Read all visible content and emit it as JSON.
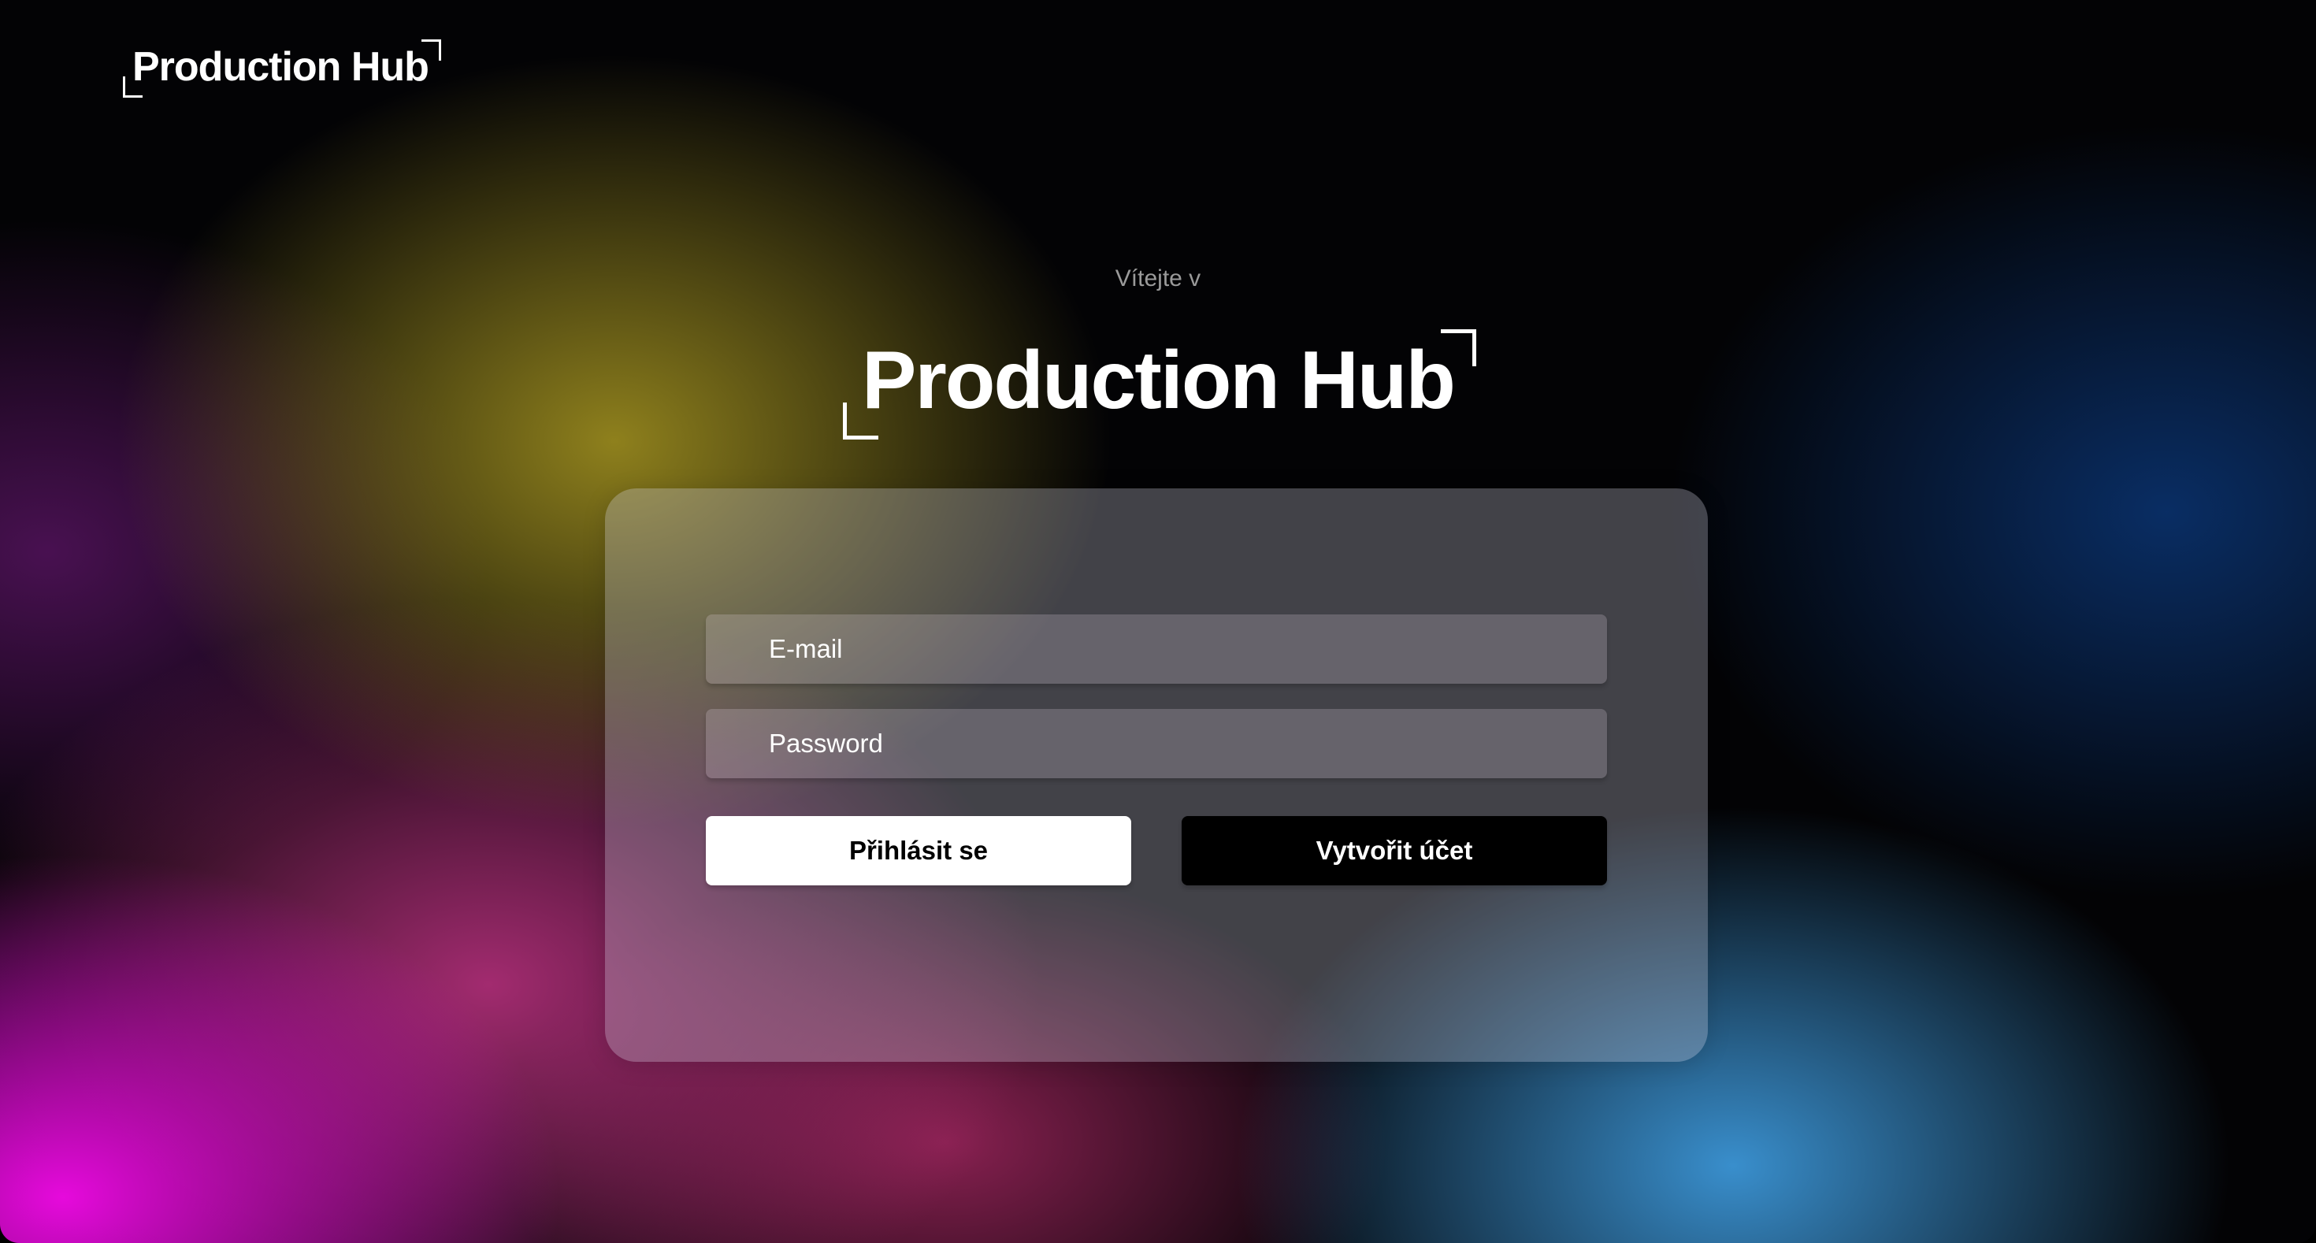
{
  "header": {
    "logo_text": "Production Hub"
  },
  "hero": {
    "welcome_text": "Vítejte v",
    "logo_text": "Production Hub"
  },
  "login_form": {
    "email_placeholder": "E-mail",
    "password_placeholder": "Password",
    "login_button_label": "Přihlásit se",
    "register_button_label": "Vytvořit účet"
  },
  "colors": {
    "primary_button_bg": "#ffffff",
    "secondary_button_bg": "#000000",
    "text": "#ffffff",
    "muted_text": "#9a9a9a"
  }
}
